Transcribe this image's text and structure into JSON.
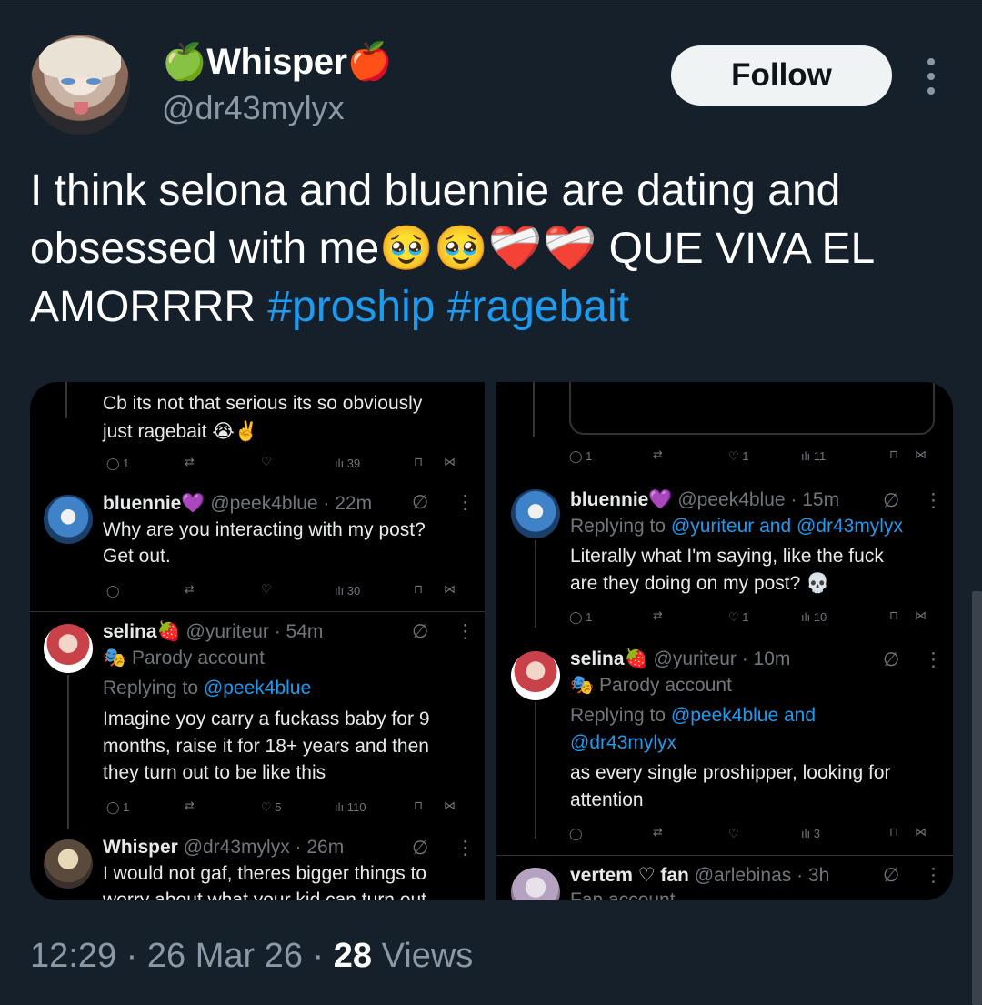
{
  "tweet": {
    "display_name": "🍏Whisper🍎",
    "handle": "@dr43mylyx",
    "follow_label": "Follow",
    "text_part1": "I think selona and bluennie are dating and obsessed with me🥹🥹❤️‍🩹❤️‍🩹 QUE VIVA EL AMORRRR",
    "hashtag1": "#proship",
    "hashtag2": "#ragebait",
    "time": "12:29",
    "date": "26 Mar 26",
    "views_count": "28",
    "views_label": "Views",
    "dot": "·"
  },
  "screenshot_left": {
    "top_reply": {
      "text_line1": "Cb its not that serious its so obviously",
      "text_line2": "just ragebait 😭✌️",
      "replies": "1",
      "views": "39"
    },
    "reply1": {
      "name": "bluennie💜",
      "handle_time": "@peek4blue · 22m",
      "text_line1": "Why are you interacting with my post?",
      "text_line2": "Get out.",
      "views": "30"
    },
    "reply2": {
      "name": "selina🍓",
      "handle_time": "@yuriteur · 54m",
      "badge": "🎭 Parody account",
      "replying_prefix": "Replying to ",
      "replying_to": "@peek4blue",
      "text_line1": "Imagine yoy carry a fuckass baby for 9",
      "text_line2": "months, raise it for 18+ years and then",
      "text_line3": "they turn out to be like this",
      "replies": "1",
      "likes": "5",
      "views": "110"
    },
    "reply3": {
      "name": "Whisper",
      "handle_time": "@dr43mylyx · 26m",
      "text_line1": "I would not gaf, theres bigger things to",
      "text_line2": "worry about what your kid can turn out"
    }
  },
  "screenshot_right": {
    "top_stats": {
      "replies": "1",
      "likes": "1",
      "views": "11"
    },
    "reply1": {
      "name": "bluennie💜",
      "handle_time": "@peek4blue · 15m",
      "replying_prefix": "Replying to ",
      "replying_to": "@yuriteur and @dr43mylyx",
      "text_line1": "Literally what I'm saying, like the fuck",
      "text_line2": "are they doing on my post? 💀",
      "replies": "1",
      "likes": "1",
      "views": "10"
    },
    "reply2": {
      "name": "selina🍓",
      "handle_time": "@yuriteur · 10m",
      "badge": "🎭 Parody account",
      "replying_prefix": "Replying to ",
      "replying_to_line1": "@peek4blue and",
      "replying_to_line2": "@dr43mylyx",
      "text_line1": "as every single proshipper, looking for",
      "text_line2": "attention",
      "views": "3"
    },
    "reply3": {
      "name": "vertem ♡ fan",
      "handle_time": "@arlebinas · 3h",
      "badge": "Fan account"
    }
  },
  "icons": [
    "apple-icon",
    "more-icon",
    "reply-icon",
    "retweet-icon",
    "like-icon",
    "views-icon",
    "bookmark-icon",
    "share-icon",
    "grok-icon"
  ],
  "colors": {
    "background": "#15202b",
    "accent": "#1d9bf0",
    "follow_button": "#eff3f4",
    "secondary_text": "#8b98a5"
  }
}
